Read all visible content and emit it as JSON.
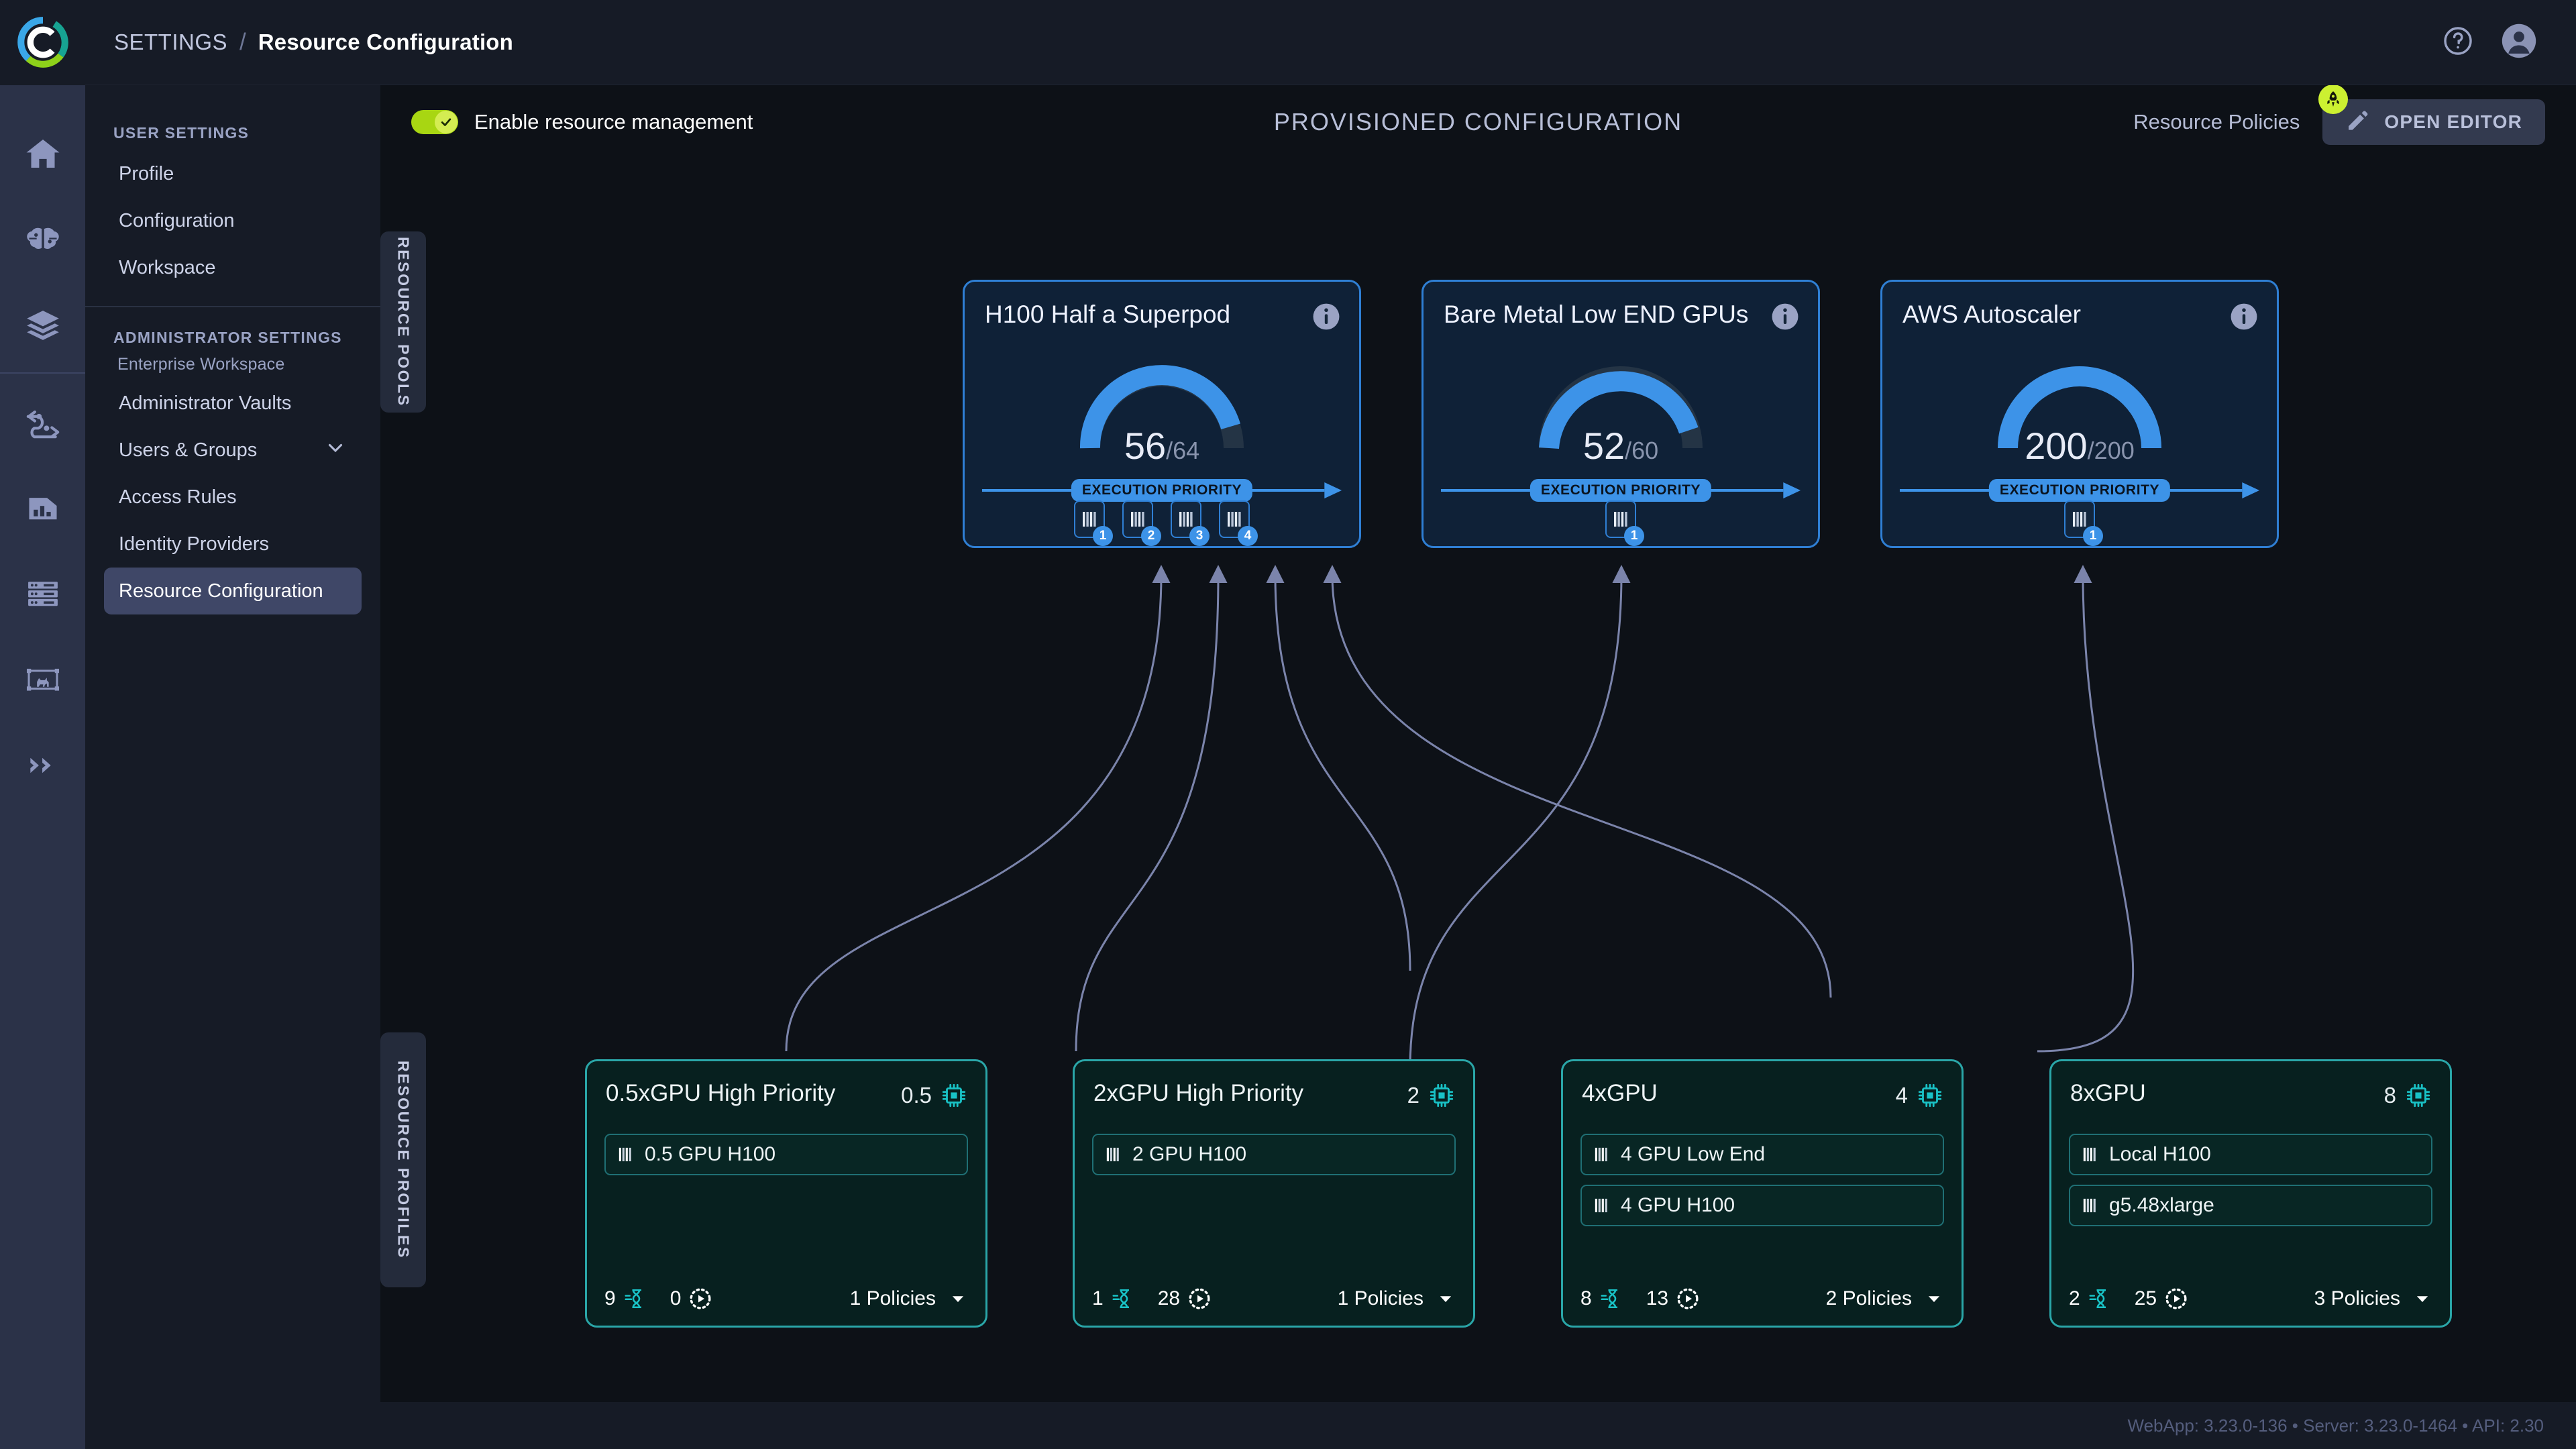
{
  "app": {
    "logo_icon": "clearml-c-logo"
  },
  "breadcrumb": {
    "parent": "SETTINGS",
    "separator": "/",
    "current": "Resource Configuration"
  },
  "topbar_right": {
    "help_icon": "help-circle-icon",
    "avatar_icon": "user-avatar-icon"
  },
  "rail": {
    "items": [
      {
        "icon": "home-icon",
        "name": "home"
      },
      {
        "icon": "brain-icon",
        "name": "models"
      },
      {
        "icon": "layers-icon",
        "name": "datasets"
      },
      {
        "icon": "pipeline-icon",
        "name": "pipelines"
      },
      {
        "icon": "reports-icon",
        "name": "reports"
      },
      {
        "icon": "server-icon",
        "name": "workers"
      },
      {
        "icon": "object-detection-icon",
        "name": "annotations"
      },
      {
        "icon": "double-chevron-right-icon",
        "name": "expand"
      }
    ]
  },
  "settings": {
    "user_settings_header": "USER SETTINGS",
    "user_items": [
      {
        "label": "Profile",
        "active": false
      },
      {
        "label": "Configuration",
        "active": false
      },
      {
        "label": "Workspace",
        "active": false
      }
    ],
    "admin_settings_header": "ADMINISTRATOR SETTINGS",
    "admin_subheader": "Enterprise Workspace",
    "admin_items": [
      {
        "label": "Administrator Vaults",
        "active": false,
        "chevron": false
      },
      {
        "label": "Users & Groups",
        "active": false,
        "chevron": true
      },
      {
        "label": "Access Rules",
        "active": false,
        "chevron": false
      },
      {
        "label": "Identity Providers",
        "active": false,
        "chevron": false
      },
      {
        "label": "Resource Configuration",
        "active": true,
        "chevron": false
      }
    ]
  },
  "toolbar": {
    "toggle_label": "Enable resource management",
    "toggle_on": true,
    "toggle_check_icon": "check-icon",
    "page_title": "PROVISIONED CONFIGURATION",
    "resource_policies_label": "Resource Policies",
    "open_editor_label": "OPEN EDITOR",
    "open_editor_icon": "pencil-icon",
    "badge_icon": "rocket-icon"
  },
  "section_tabs": {
    "pools": "RESOURCE POOLS",
    "profiles": "RESOURCE PROFILES"
  },
  "colors": {
    "pool_accent": "#3d93e8",
    "profile_accent": "#2aa6a8",
    "toggle_on": "#a8d612",
    "badge": "#ccf031",
    "edge": "#7b84ab",
    "sidebar_active": "#3f4767"
  },
  "pools": [
    {
      "name": "H100 Half a Superpod",
      "used": 56,
      "total": 64,
      "max_label": "/64",
      "info_icon": "info-icon",
      "priority_label": "EXECUTION PRIORITY",
      "slots": [
        {
          "index": "1",
          "icon": "gpu-bars-icon"
        },
        {
          "index": "2",
          "icon": "gpu-bars-icon"
        },
        {
          "index": "3",
          "icon": "gpu-bars-icon"
        },
        {
          "index": "4",
          "icon": "gpu-bars-icon"
        }
      ]
    },
    {
      "name": "Bare Metal Low END GPUs",
      "used": 52,
      "total": 60,
      "max_label": "/60",
      "info_icon": "info-icon",
      "priority_label": "EXECUTION PRIORITY",
      "slots": [
        {
          "index": "1",
          "icon": "gpu-bars-icon"
        }
      ]
    },
    {
      "name": "AWS Autoscaler",
      "used": 200,
      "total": 200,
      "max_label": "/200",
      "info_icon": "info-icon",
      "priority_label": "EXECUTION PRIORITY",
      "slots": [
        {
          "index": "1",
          "icon": "gpu-bars-icon"
        }
      ]
    }
  ],
  "profiles": [
    {
      "name": "0.5xGPU High Priority",
      "gpu_count": "0.5",
      "gpu_icon": "chip-icon",
      "rows": [
        {
          "label": "0.5 GPU H100",
          "icon": "gpu-bars-icon"
        }
      ],
      "queued": "9",
      "queued_icon": "hourglass-queue-icon",
      "running": "0",
      "running_icon": "running-play-icon",
      "policies_label": "1 Policies",
      "chevron_icon": "chevron-down-icon"
    },
    {
      "name": "2xGPU High Priority",
      "gpu_count": "2",
      "gpu_icon": "chip-icon",
      "rows": [
        {
          "label": "2 GPU H100",
          "icon": "gpu-bars-icon"
        }
      ],
      "queued": "1",
      "queued_icon": "hourglass-queue-icon",
      "running": "28",
      "running_icon": "running-play-icon",
      "policies_label": "1 Policies",
      "chevron_icon": "chevron-down-icon"
    },
    {
      "name": "4xGPU",
      "gpu_count": "4",
      "gpu_icon": "chip-icon",
      "rows": [
        {
          "label": "4 GPU Low End",
          "icon": "gpu-bars-icon"
        },
        {
          "label": "4 GPU H100",
          "icon": "gpu-bars-icon"
        }
      ],
      "queued": "8",
      "queued_icon": "hourglass-queue-icon",
      "running": "13",
      "running_icon": "running-play-icon",
      "policies_label": "2 Policies",
      "chevron_icon": "chevron-down-icon"
    },
    {
      "name": "8xGPU",
      "gpu_count": "8",
      "gpu_icon": "chip-icon",
      "rows": [
        {
          "label": "Local H100",
          "icon": "gpu-bars-icon"
        },
        {
          "label": "g5.48xlarge",
          "icon": "gpu-bars-icon"
        }
      ],
      "queued": "2",
      "queued_icon": "hourglass-queue-icon",
      "running": "25",
      "running_icon": "running-play-icon",
      "policies_label": "3 Policies",
      "chevron_icon": "chevron-down-icon"
    }
  ],
  "footer": {
    "versions": "WebApp: 3.23.0-136 • Server: 3.23.0-1464 • API: 2.30"
  }
}
